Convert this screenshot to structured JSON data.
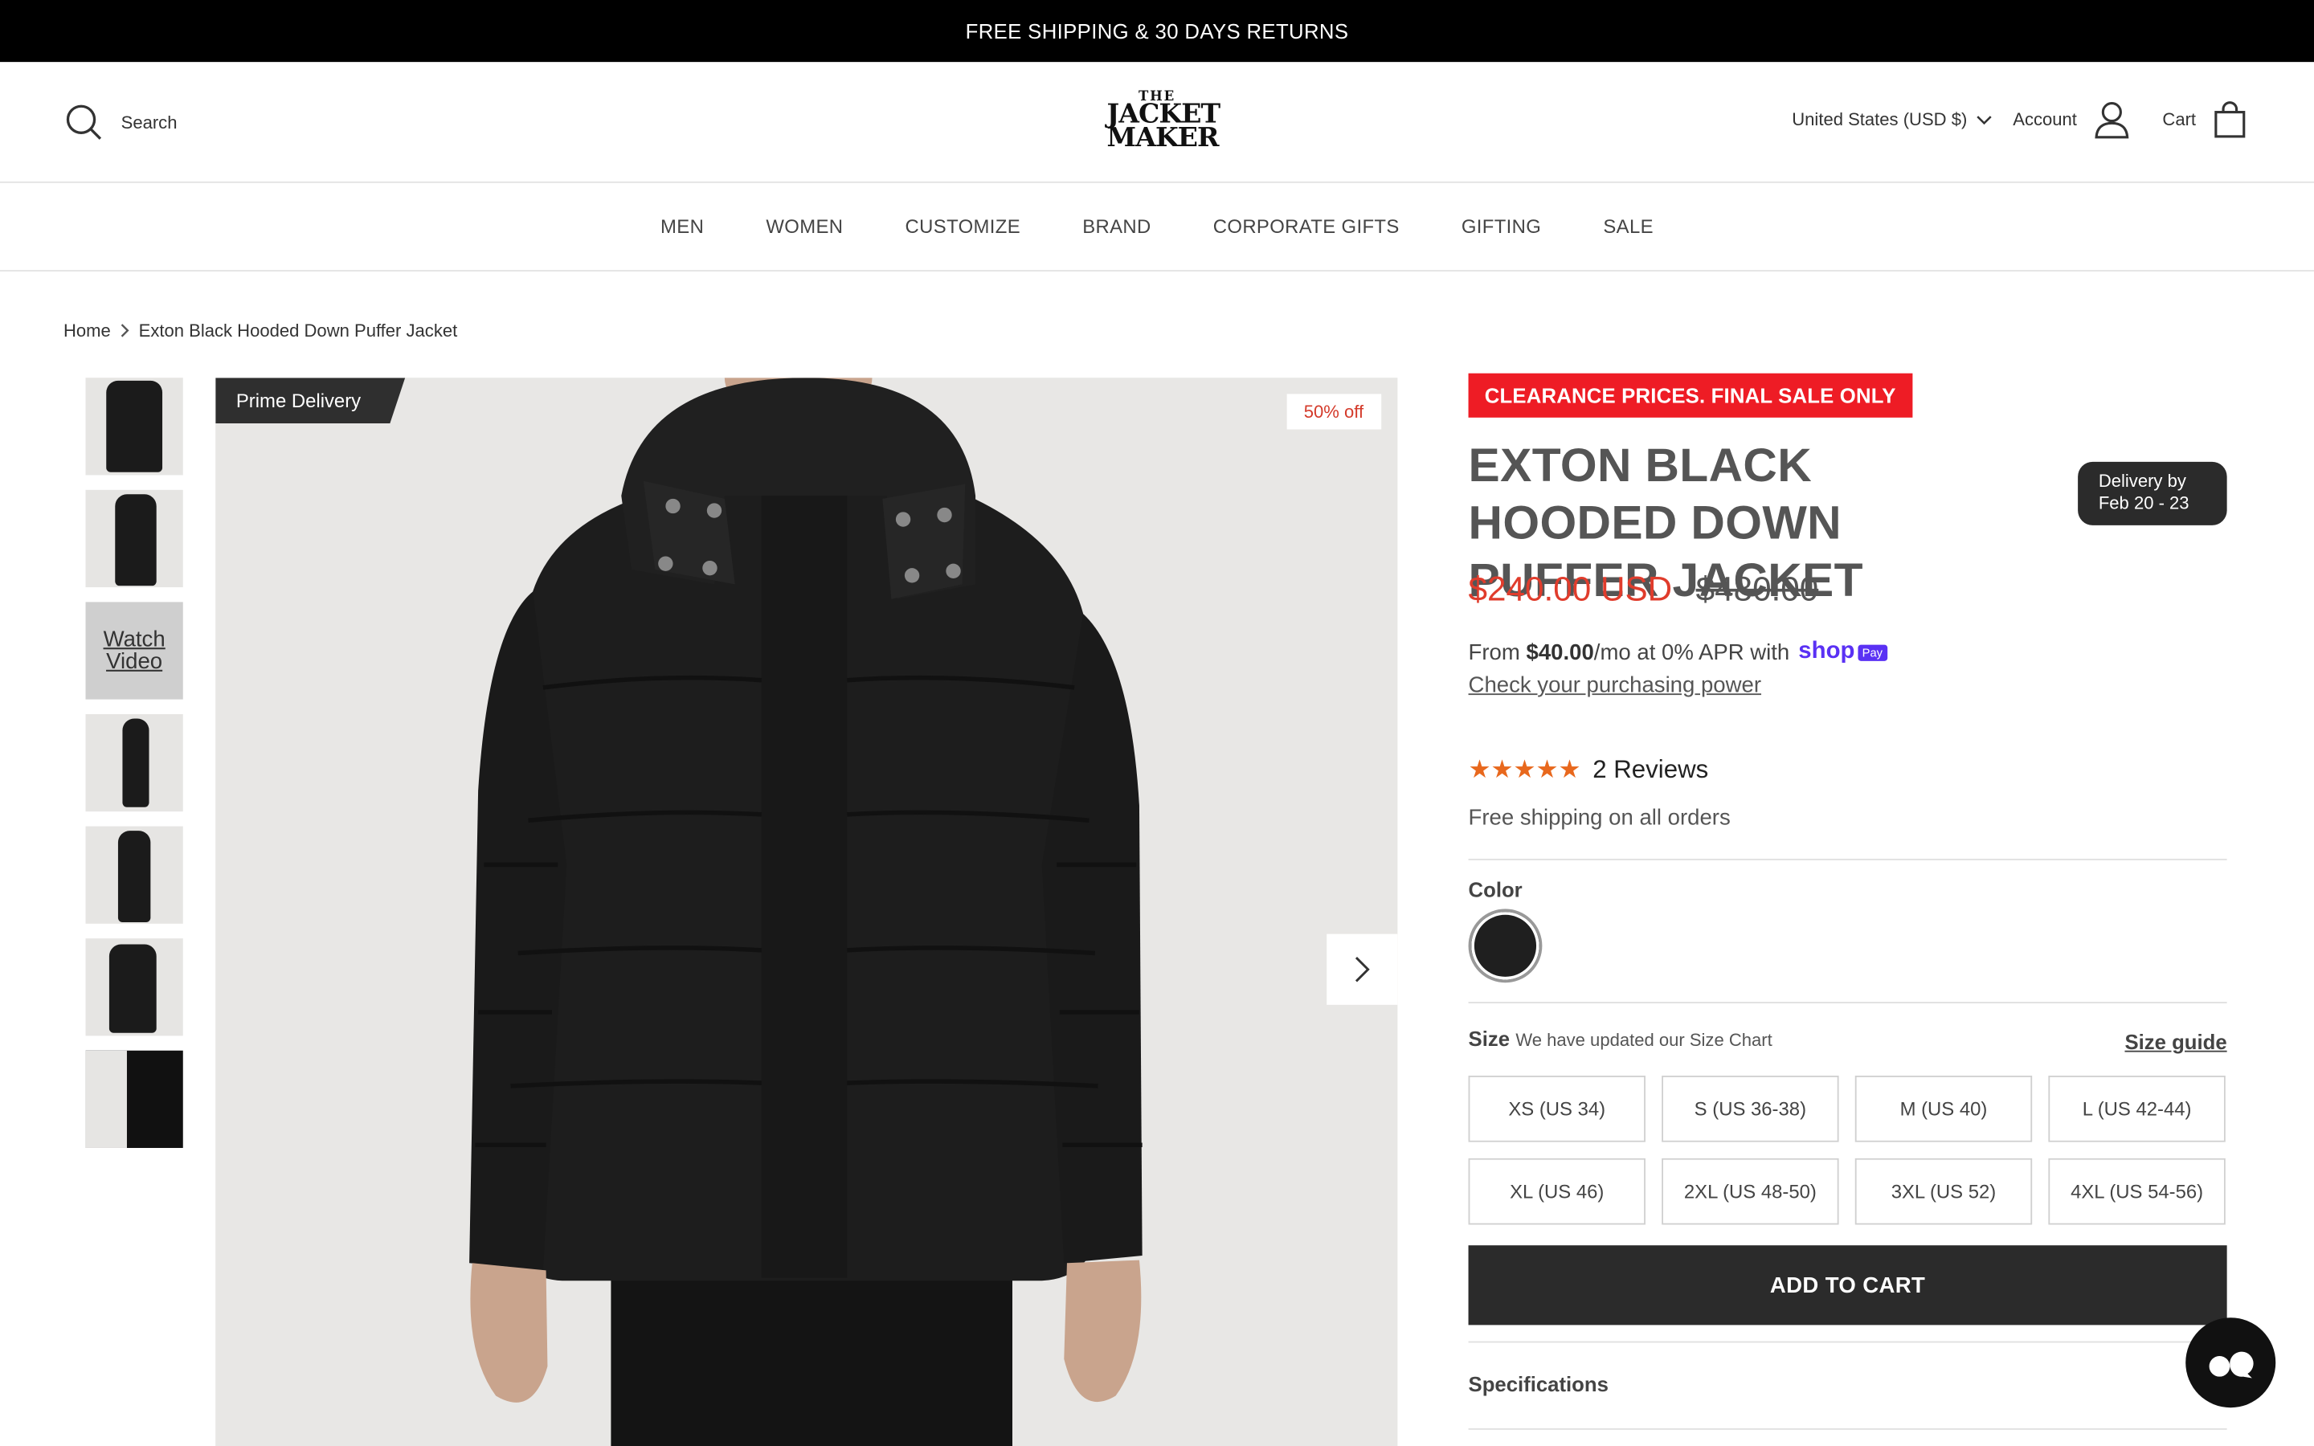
{
  "announcement": "FREE SHIPPING & 30 DAYS RETURNS",
  "header": {
    "search_label": "Search",
    "logo": {
      "line1": "THE",
      "line2": "JACKET",
      "line3": "MAKER"
    },
    "country": "United States (USD $)",
    "account_label": "Account",
    "cart_label": "Cart"
  },
  "nav": [
    "MEN",
    "WOMEN",
    "CUSTOMIZE",
    "BRAND",
    "CORPORATE GIFTS",
    "GIFTING",
    "SALE"
  ],
  "breadcrumb": {
    "home": "Home",
    "current": "Exton Black Hooded Down Puffer Jacket"
  },
  "gallery": {
    "video_label_1": "Watch",
    "video_label_2": "Video",
    "badge_left": "Prime Delivery",
    "badge_right": "50% off"
  },
  "product": {
    "clearance": "CLEARANCE PRICES. FINAL SALE ONLY",
    "title": "EXTON BLACK HOODED DOWN PUFFER JACKET",
    "delivery_line1": "Delivery by",
    "delivery_line2": "Feb 20 - 23",
    "price": "$240.00 USD",
    "compare_price": "$480.00",
    "shoppay_prefix": "From ",
    "shoppay_amount": "$40.00",
    "shoppay_suffix": "/mo at 0% APR with",
    "shoppay_brand": "shop",
    "shoppay_pay": "Pay",
    "purchasing_power": "Check your purchasing power",
    "stars": "★★★★★",
    "rating": 5,
    "reviews": "2 Reviews",
    "free_shipping": "Free shipping on all orders",
    "color_label": "Color",
    "size_label": "Size",
    "size_note": "We have updated our Size Chart",
    "size_guide": "Size guide",
    "sizes": [
      "XS (US 34)",
      "S (US 36-38)",
      "M (US 40)",
      "L (US 42-44)",
      "XL (US 46)",
      "2XL (US 48-50)",
      "3XL (US 52)",
      "4XL (US 54-56)"
    ],
    "add_to_cart": "ADD TO CART",
    "specifications": "Specifications"
  },
  "colors": {
    "accent_red": "#ee1c25",
    "sale_price": "#e03c2c",
    "stars": "#e8681d",
    "shoppay": "#5a31f4",
    "button_dark": "#2b2b2b"
  }
}
